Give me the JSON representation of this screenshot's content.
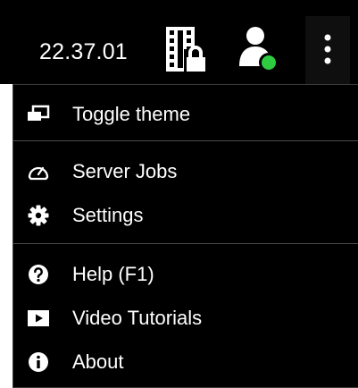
{
  "topbar": {
    "version": "22.37.01",
    "icons": {
      "film": "film-lock-icon",
      "user": "user-online-icon",
      "more": "more-vertical-icon"
    },
    "status_color": "#2ecc40"
  },
  "menu": {
    "items": [
      {
        "label": "Toggle theme",
        "icon": "toggle-theme-icon"
      },
      {
        "label": "Server Jobs",
        "icon": "gauge-icon"
      },
      {
        "label": "Settings",
        "icon": "gear-icon"
      },
      {
        "label": "Help (F1)",
        "icon": "help-icon"
      },
      {
        "label": "Video Tutorials",
        "icon": "video-play-icon"
      },
      {
        "label": "About",
        "icon": "info-icon"
      }
    ]
  }
}
